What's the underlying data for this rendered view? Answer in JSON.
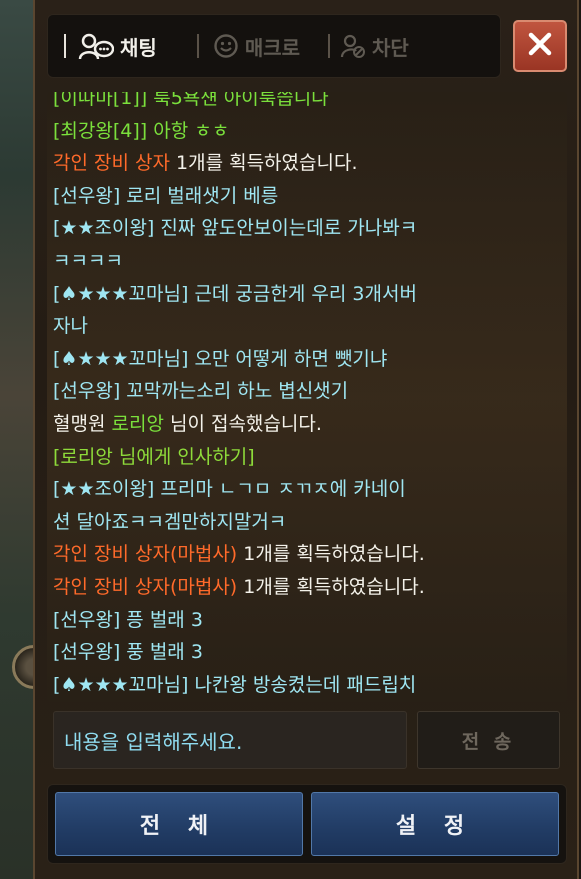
{
  "tabs": [
    {
      "label": "채팅",
      "icon": "chat-bubble-person-icon",
      "active": true
    },
    {
      "label": "매크로",
      "icon": "smiley-icon",
      "active": false
    },
    {
      "label": "차단",
      "icon": "block-user-icon",
      "active": false
    }
  ],
  "close_icon": "close-icon",
  "messages": [
    {
      "color": "green",
      "text": "[이따마[1]] 룩5욕섄 아이룩씁니다"
    },
    {
      "color": "green",
      "text": "[최강왕[4]] 아항 ㅎㅎ"
    },
    {
      "parts": [
        {
          "color": "orange",
          "text": "각인 장비 상자"
        },
        {
          "color": "white",
          "text": " 1개를 획득하였습니다."
        }
      ]
    },
    {
      "color": "cyan",
      "text": "[선우왕] 로리 벌래샛기 베릉"
    },
    {
      "color": "cyan",
      "text": "[★★조이왕] 진짜 앞도안보이는데로 가나봐ㅋ"
    },
    {
      "color": "cyan",
      "text": "ㅋㅋㅋㅋ"
    },
    {
      "color": "cyan",
      "text": "[♠★★★꼬마님] 근데 궁금한게 우리 3개서버"
    },
    {
      "color": "cyan",
      "text": "자나"
    },
    {
      "color": "cyan",
      "text": "[♠★★★꼬마님] 오만 어떻게 하면 뺏기냐"
    },
    {
      "color": "cyan",
      "text": "[선우왕] 꼬막까는소리 하노 볍신샛기"
    },
    {
      "parts": [
        {
          "color": "white",
          "text": "혈맹원 "
        },
        {
          "color": "green",
          "text": "로리앙"
        },
        {
          "color": "white",
          "text": " 님이 접속했습니다."
        }
      ]
    },
    {
      "color": "yellowgreen",
      "text": "[로리앙 님에게 인사하기]"
    },
    {
      "color": "cyan",
      "text": "[★★조이왕] 프리마 ㄴㄱㅁ ㅈㄲㅈ에 카네이"
    },
    {
      "color": "cyan",
      "text": "션 달아죠ㅋㅋ겜만하지말거ㅋ"
    },
    {
      "parts": [
        {
          "color": "orange",
          "text": "각인 장비 상자(마법사)"
        },
        {
          "color": "white",
          "text": " 1개를 획득하였습니다."
        }
      ]
    },
    {
      "parts": [
        {
          "color": "orange",
          "text": "각인 장비 상자(마법사)"
        },
        {
          "color": "white",
          "text": " 1개를 획득하였습니다."
        }
      ]
    },
    {
      "color": "cyan",
      "text": "[선우왕] 픙 벌래 3"
    },
    {
      "color": "cyan",
      "text": "[선우왕] 풍 벌래 3"
    },
    {
      "color": "cyan",
      "text": "[♠★★★꼬마님] 나칸왕 방송켰는데 패드립치"
    }
  ],
  "input": {
    "placeholder": "내용을 입력해주세요."
  },
  "send_label": "전 송",
  "buttons": {
    "all": "전 체",
    "settings": "설 정"
  }
}
